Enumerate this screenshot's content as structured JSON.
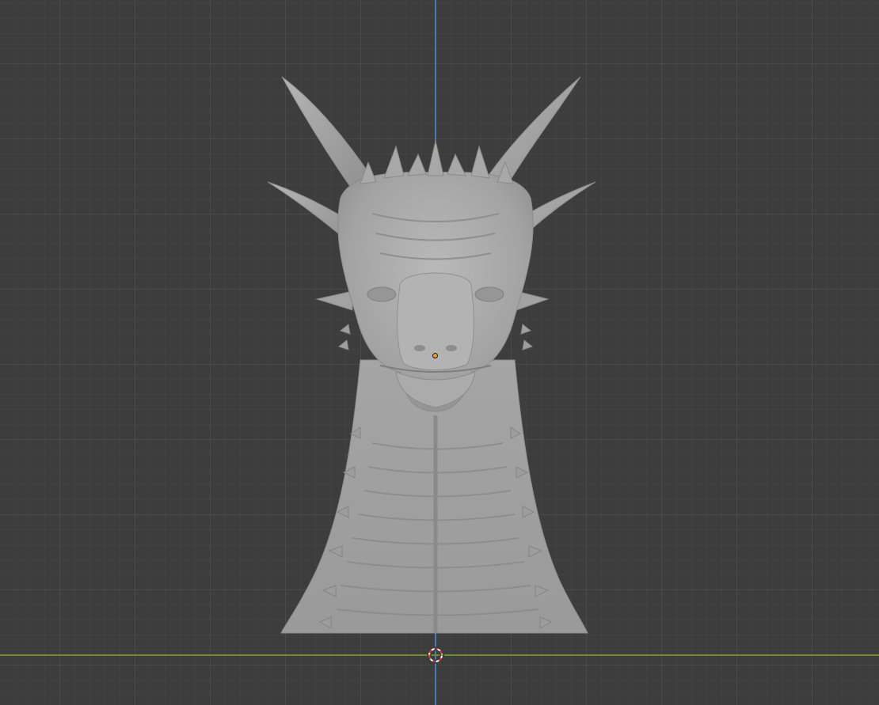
{
  "viewport": {
    "background_color": "#3d3d3d",
    "grid_color": "#4a4a4a",
    "axis_z_color": "#4a78b8",
    "axis_y_color": "#6f8e2a"
  },
  "object": {
    "type": "sculpted mesh",
    "shading_color": "#a9a9a9",
    "origin_color": "#f39a2b"
  },
  "cursor": {
    "icon": "3d-cursor-icon",
    "colors": [
      "#e03030",
      "#ffffff"
    ]
  }
}
